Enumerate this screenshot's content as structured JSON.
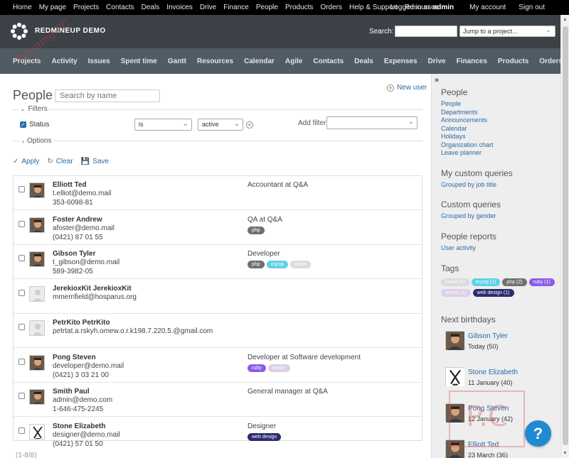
{
  "top_menu": {
    "items": [
      "Home",
      "My page",
      "Projects",
      "Contacts",
      "Deals",
      "Invoices",
      "Drive",
      "Finance",
      "People",
      "Products",
      "Orders",
      "Help & Support",
      "Resources"
    ],
    "logged_in_prefix": "Logged in as",
    "logged_in_user": "admin",
    "my_account": "My account",
    "sign_out": "Sign out"
  },
  "header": {
    "title": "REDMINEUP DEMO",
    "search_label": "Search:",
    "project_jump": "Jump to a project..."
  },
  "main_menu": [
    "Projects",
    "Activity",
    "Issues",
    "Spent time",
    "Gantt",
    "Resources",
    "Calendar",
    "Agile",
    "Contacts",
    "Deals",
    "Expenses",
    "Drive",
    "Finances",
    "Products",
    "Orders"
  ],
  "watermark_text": "Winning PC",
  "page": {
    "title": "People",
    "search_placeholder": "Search by name",
    "new_user": "New user"
  },
  "filters": {
    "legend": "Filters",
    "status_label": "Status",
    "operator": "is",
    "value": "active",
    "add_filter_label": "Add filter",
    "options_legend": "Options"
  },
  "actions": {
    "apply": "Apply",
    "clear": "Clear",
    "save": "Save"
  },
  "people": [
    {
      "name": "Elliott Ted",
      "email": "t.elliot@demo.mail",
      "phone": "353-6098-81",
      "job": "Accountant at Q&A",
      "tags": [],
      "avatar": "photo"
    },
    {
      "name": "Foster Andrew",
      "email": "afoster@demo.mail",
      "phone": "(0421) 87 01 55",
      "job": "QA at Q&A",
      "tags": [
        "php"
      ],
      "avatar": "photo"
    },
    {
      "name": "Gibson Tyler",
      "email": "t_gibson@demo.mail",
      "phone": "589-3982-05",
      "job": "Developer",
      "tags": [
        "php",
        "mysql",
        "junior"
      ],
      "avatar": "photo"
    },
    {
      "name": "JerekioxKit JerekioxKit",
      "email": "mmerrifield@hosparus.org",
      "phone": "",
      "job": "",
      "tags": [],
      "avatar": "default"
    },
    {
      "name": "PetrKito PetrKito",
      "email": "petrtat.a.rskyh.omew.o.r.k198.7.220.5.@gmail.com",
      "phone": "",
      "job": "",
      "tags": [],
      "avatar": "default"
    },
    {
      "name": "Pong Steven",
      "email": "developer@demo.mail",
      "phone": "(0421) 3 03 21 00",
      "job": "Developer at Software development",
      "tags": [
        "ruby",
        "senior"
      ],
      "avatar": "photo"
    },
    {
      "name": "Smith Paul",
      "email": "admin@demo.com",
      "phone": "1-646-475-2245",
      "job": "General manager at Q&A",
      "tags": [],
      "avatar": "photo"
    },
    {
      "name": "Stone Elizabeth",
      "email": "designer@demo.mail",
      "phone": "(0421) 57 01 50",
      "job": "Designer",
      "tags": [
        "web design"
      ],
      "avatar": "sketch"
    }
  ],
  "tag_colors": {
    "php": "#6f6f6f",
    "mysql": "#5ed1e6",
    "junior": "#d9dcdd",
    "ruby": "#8a5ce8",
    "senior": "#dccfe8",
    "web design": "#2c2b6e"
  },
  "pagination": "(1-8/8)",
  "sidebar": {
    "people_title": "People",
    "people_links": [
      "People",
      "Departments",
      "Announcements",
      "Calendar",
      "Holidays",
      "Organization chart",
      "Leave planner"
    ],
    "my_queries_title": "My custom queries",
    "my_queries": [
      "Grouped by job title"
    ],
    "custom_queries_title": "Custom queries",
    "custom_queries": [
      "Grouped by gender"
    ],
    "reports_title": "People reports",
    "reports": [
      "User activity"
    ],
    "tags_title": "Tags",
    "tags": [
      {
        "label": "junior (1)",
        "color": "#d9dcdd"
      },
      {
        "label": "mysql (1)",
        "color": "#5ed1e6"
      },
      {
        "label": "php (2)",
        "color": "#6f6f6f"
      },
      {
        "label": "ruby (1)",
        "color": "#8a5ce8"
      },
      {
        "label": "senior (1)",
        "color": "#dccfe8"
      },
      {
        "label": "web design (1)",
        "color": "#2c2b6e"
      }
    ],
    "birthdays_title": "Next birthdays",
    "birthdays": [
      {
        "name": "Gibson Tyler",
        "date": "Today (50)"
      },
      {
        "name": "Stone Elizabeth",
        "date": "11 January (40)"
      },
      {
        "name": "Pong Steven",
        "date": "12 January (42)"
      },
      {
        "name": "Elliott Ted",
        "date": "23 March (36)"
      }
    ]
  },
  "help_button": "?",
  "pc_watermark": "P.C"
}
